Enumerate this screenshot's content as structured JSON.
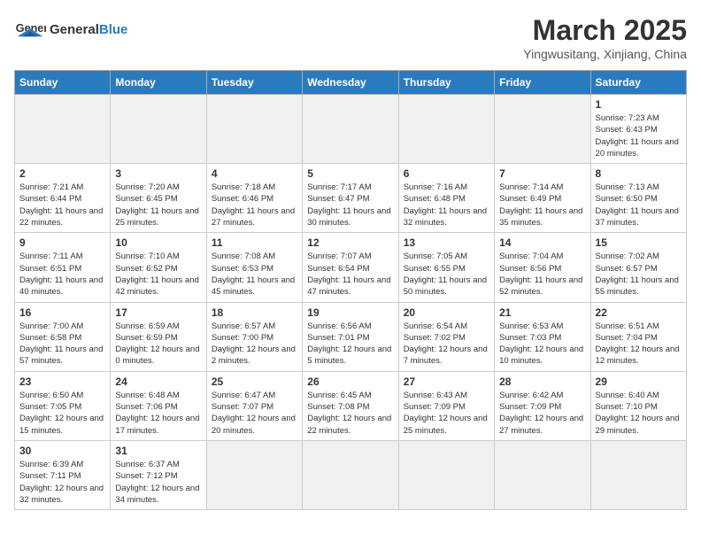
{
  "logo": {
    "text_general": "General",
    "text_blue": "Blue"
  },
  "header": {
    "month": "March 2025",
    "location": "Yingwusitang, Xinjiang, China"
  },
  "weekdays": [
    "Sunday",
    "Monday",
    "Tuesday",
    "Wednesday",
    "Thursday",
    "Friday",
    "Saturday"
  ],
  "weeks": [
    [
      {
        "day": "",
        "empty": true
      },
      {
        "day": "",
        "empty": true
      },
      {
        "day": "",
        "empty": true
      },
      {
        "day": "",
        "empty": true
      },
      {
        "day": "",
        "empty": true
      },
      {
        "day": "",
        "empty": true
      },
      {
        "day": "1",
        "sunrise": "7:23 AM",
        "sunset": "6:43 PM",
        "daylight": "11 hours and 20 minutes."
      }
    ],
    [
      {
        "day": "2",
        "sunrise": "7:21 AM",
        "sunset": "6:44 PM",
        "daylight": "11 hours and 22 minutes."
      },
      {
        "day": "3",
        "sunrise": "7:20 AM",
        "sunset": "6:45 PM",
        "daylight": "11 hours and 25 minutes."
      },
      {
        "day": "4",
        "sunrise": "7:18 AM",
        "sunset": "6:46 PM",
        "daylight": "11 hours and 27 minutes."
      },
      {
        "day": "5",
        "sunrise": "7:17 AM",
        "sunset": "6:47 PM",
        "daylight": "11 hours and 30 minutes."
      },
      {
        "day": "6",
        "sunrise": "7:16 AM",
        "sunset": "6:48 PM",
        "daylight": "11 hours and 32 minutes."
      },
      {
        "day": "7",
        "sunrise": "7:14 AM",
        "sunset": "6:49 PM",
        "daylight": "11 hours and 35 minutes."
      },
      {
        "day": "8",
        "sunrise": "7:13 AM",
        "sunset": "6:50 PM",
        "daylight": "11 hours and 37 minutes."
      }
    ],
    [
      {
        "day": "9",
        "sunrise": "7:11 AM",
        "sunset": "6:51 PM",
        "daylight": "11 hours and 40 minutes."
      },
      {
        "day": "10",
        "sunrise": "7:10 AM",
        "sunset": "6:52 PM",
        "daylight": "11 hours and 42 minutes."
      },
      {
        "day": "11",
        "sunrise": "7:08 AM",
        "sunset": "6:53 PM",
        "daylight": "11 hours and 45 minutes."
      },
      {
        "day": "12",
        "sunrise": "7:07 AM",
        "sunset": "6:54 PM",
        "daylight": "11 hours and 47 minutes."
      },
      {
        "day": "13",
        "sunrise": "7:05 AM",
        "sunset": "6:55 PM",
        "daylight": "11 hours and 50 minutes."
      },
      {
        "day": "14",
        "sunrise": "7:04 AM",
        "sunset": "6:56 PM",
        "daylight": "11 hours and 52 minutes."
      },
      {
        "day": "15",
        "sunrise": "7:02 AM",
        "sunset": "6:57 PM",
        "daylight": "11 hours and 55 minutes."
      }
    ],
    [
      {
        "day": "16",
        "sunrise": "7:00 AM",
        "sunset": "6:58 PM",
        "daylight": "11 hours and 57 minutes."
      },
      {
        "day": "17",
        "sunrise": "6:59 AM",
        "sunset": "6:59 PM",
        "daylight": "12 hours and 0 minutes."
      },
      {
        "day": "18",
        "sunrise": "6:57 AM",
        "sunset": "7:00 PM",
        "daylight": "12 hours and 2 minutes."
      },
      {
        "day": "19",
        "sunrise": "6:56 AM",
        "sunset": "7:01 PM",
        "daylight": "12 hours and 5 minutes."
      },
      {
        "day": "20",
        "sunrise": "6:54 AM",
        "sunset": "7:02 PM",
        "daylight": "12 hours and 7 minutes."
      },
      {
        "day": "21",
        "sunrise": "6:53 AM",
        "sunset": "7:03 PM",
        "daylight": "12 hours and 10 minutes."
      },
      {
        "day": "22",
        "sunrise": "6:51 AM",
        "sunset": "7:04 PM",
        "daylight": "12 hours and 12 minutes."
      }
    ],
    [
      {
        "day": "23",
        "sunrise": "6:50 AM",
        "sunset": "7:05 PM",
        "daylight": "12 hours and 15 minutes."
      },
      {
        "day": "24",
        "sunrise": "6:48 AM",
        "sunset": "7:06 PM",
        "daylight": "12 hours and 17 minutes."
      },
      {
        "day": "25",
        "sunrise": "6:47 AM",
        "sunset": "7:07 PM",
        "daylight": "12 hours and 20 minutes."
      },
      {
        "day": "26",
        "sunrise": "6:45 AM",
        "sunset": "7:08 PM",
        "daylight": "12 hours and 22 minutes."
      },
      {
        "day": "27",
        "sunrise": "6:43 AM",
        "sunset": "7:09 PM",
        "daylight": "12 hours and 25 minutes."
      },
      {
        "day": "28",
        "sunrise": "6:42 AM",
        "sunset": "7:09 PM",
        "daylight": "12 hours and 27 minutes."
      },
      {
        "day": "29",
        "sunrise": "6:40 AM",
        "sunset": "7:10 PM",
        "daylight": "12 hours and 29 minutes."
      }
    ],
    [
      {
        "day": "30",
        "sunrise": "6:39 AM",
        "sunset": "7:11 PM",
        "daylight": "12 hours and 32 minutes."
      },
      {
        "day": "31",
        "sunrise": "6:37 AM",
        "sunset": "7:12 PM",
        "daylight": "12 hours and 34 minutes."
      },
      {
        "day": "",
        "empty": true
      },
      {
        "day": "",
        "empty": true
      },
      {
        "day": "",
        "empty": true
      },
      {
        "day": "",
        "empty": true
      },
      {
        "day": "",
        "empty": true
      }
    ]
  ],
  "labels": {
    "sunrise": "Sunrise:",
    "sunset": "Sunset:",
    "daylight": "Daylight:"
  }
}
